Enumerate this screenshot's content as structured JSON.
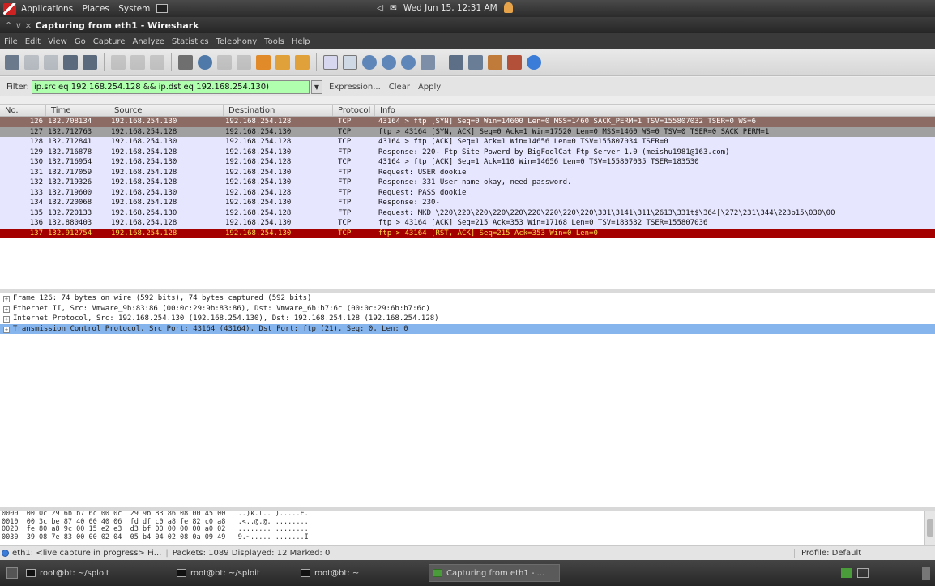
{
  "topbar": {
    "menus": [
      "Applications",
      "Places",
      "System"
    ],
    "datetime": "Wed Jun 15, 12:31 AM"
  },
  "window": {
    "title": "Capturing from eth1 - Wireshark",
    "window_buttons": "^ ∨ ×"
  },
  "menubar": [
    "File",
    "Edit",
    "View",
    "Go",
    "Capture",
    "Analyze",
    "Statistics",
    "Telephony",
    "Tools",
    "Help"
  ],
  "filter": {
    "label": "Filter:",
    "value": "ip.src eq 192.168.254.128 && ip.dst eq 192.168.254.130)",
    "expression": "Expression...",
    "clear": "Clear",
    "apply": "Apply",
    "valid_color": "#afffaf"
  },
  "columns": [
    "No.",
    "Time",
    "Source",
    "Destination",
    "Protocol",
    "Info"
  ],
  "packets": [
    {
      "no": "126",
      "time": "132.708134",
      "src": "192.168.254.130",
      "dst": "192.168.254.128",
      "proto": "TCP",
      "info": "43164 > ftp [SYN] Seq=0 Win=14600 Len=0 MSS=1460 SACK_PERM=1 TSV=155807032 TSER=0 WS=6",
      "bg": "#8b6b63",
      "fg": "#ffffff"
    },
    {
      "no": "127",
      "time": "132.712763",
      "src": "192.168.254.128",
      "dst": "192.168.254.130",
      "proto": "TCP",
      "info": "ftp > 43164 [SYN, ACK] Seq=0 Ack=1 Win=17520 Len=0 MSS=1460 WS=0 TSV=0 TSER=0 SACK_PERM=1",
      "bg": "#a0a0a0",
      "fg": "#111111"
    },
    {
      "no": "128",
      "time": "132.712841",
      "src": "192.168.254.130",
      "dst": "192.168.254.128",
      "proto": "TCP",
      "info": "43164 > ftp [ACK] Seq=1 Ack=1 Win=14656 Len=0 TSV=155807034 TSER=0",
      "bg": "#e7e6ff",
      "fg": "#111111"
    },
    {
      "no": "129",
      "time": "132.716878",
      "src": "192.168.254.128",
      "dst": "192.168.254.130",
      "proto": "FTP",
      "info": "Response: 220- Ftp Site Powerd by BigFoolCat Ftp Server 1.0 (meishu1981@163.com)",
      "bg": "#e7e6ff",
      "fg": "#111111"
    },
    {
      "no": "130",
      "time": "132.716954",
      "src": "192.168.254.130",
      "dst": "192.168.254.128",
      "proto": "TCP",
      "info": "43164 > ftp [ACK] Seq=1 Ack=110 Win=14656 Len=0 TSV=155807035 TSER=183530",
      "bg": "#e7e6ff",
      "fg": "#111111"
    },
    {
      "no": "131",
      "time": "132.717059",
      "src": "192.168.254.128",
      "dst": "192.168.254.130",
      "proto": "FTP",
      "info": "Request: USER dookie",
      "bg": "#e7e6ff",
      "fg": "#111111"
    },
    {
      "no": "132",
      "time": "132.719326",
      "src": "192.168.254.128",
      "dst": "192.168.254.130",
      "proto": "FTP",
      "info": "Response: 331 User name okay, need password.",
      "bg": "#e7e6ff",
      "fg": "#111111"
    },
    {
      "no": "133",
      "time": "132.719600",
      "src": "192.168.254.130",
      "dst": "192.168.254.128",
      "proto": "FTP",
      "info": "Request: PASS dookie",
      "bg": "#e7e6ff",
      "fg": "#111111"
    },
    {
      "no": "134",
      "time": "132.720068",
      "src": "192.168.254.128",
      "dst": "192.168.254.130",
      "proto": "FTP",
      "info": "Response: 230-",
      "bg": "#e7e6ff",
      "fg": "#111111"
    },
    {
      "no": "135",
      "time": "132.720133",
      "src": "192.168.254.130",
      "dst": "192.168.254.128",
      "proto": "FTP",
      "info": "Request: MKD \\220\\220\\220\\220\\220\\220\\220\\220\\220\\331\\3141\\311\\2613\\331t$\\364[\\272\\231\\344\\223b15\\030\\00",
      "bg": "#e7e6ff",
      "fg": "#111111"
    },
    {
      "no": "136",
      "time": "132.880403",
      "src": "192.168.254.128",
      "dst": "192.168.254.130",
      "proto": "TCP",
      "info": "ftp > 43164 [ACK] Seq=215 Ack=353 Win=17168 Len=0 TSV=183532 TSER=155807036",
      "bg": "#e7e6ff",
      "fg": "#111111"
    },
    {
      "no": "137",
      "time": "132.912754",
      "src": "192.168.254.128",
      "dst": "192.168.254.130",
      "proto": "TCP",
      "info": "ftp > 43164 [RST, ACK] Seq=215 Ack=353 Win=0 Len=0",
      "bg": "#a40000",
      "fg": "#ffd84a"
    }
  ],
  "details": [
    {
      "text": "Frame 126: 74 bytes on wire (592 bits), 74 bytes captured (592 bits)",
      "selected": false
    },
    {
      "text": "Ethernet II, Src: Vmware_9b:83:86 (00:0c:29:9b:83:86), Dst: Vmware_6b:b7:6c (00:0c:29:6b:b7:6c)",
      "selected": false
    },
    {
      "text": "Internet Protocol, Src: 192.168.254.130 (192.168.254.130), Dst: 192.168.254.128 (192.168.254.128)",
      "selected": false
    },
    {
      "text": "Transmission Control Protocol, Src Port: 43164 (43164), Dst Port: ftp (21), Seq: 0, Len: 0",
      "selected": true
    }
  ],
  "hex": [
    "0000  00 0c 29 6b b7 6c 00 0c  29 9b 83 86 08 00 45 00   ..)k.l.. ).....E.",
    "0010  00 3c be 87 40 00 40 06  fd df c0 a8 fe 82 c0 a8   .<..@.@. ........",
    "0020  fe 80 a8 9c 00 15 e2 e3  d3 bf 00 00 00 00 a0 02   ........ ........",
    "0030  39 08 7e 83 00 00 02 04  05 b4 04 02 08 0a 09 49   9.~..... .......I"
  ],
  "status": {
    "capture": "eth1: <live capture in progress> Fi...",
    "packets": "Packets: 1089 Displayed: 12 Marked: 0",
    "profile": "Profile: Default"
  },
  "taskbar": [
    "root@bt: ~/sploit",
    "root@bt: ~/sploit",
    "root@bt: ~",
    "Capturing from eth1 - ..."
  ],
  "colors": {
    "selected_detail": "#86b5ee",
    "rst_row": "#a40000"
  }
}
